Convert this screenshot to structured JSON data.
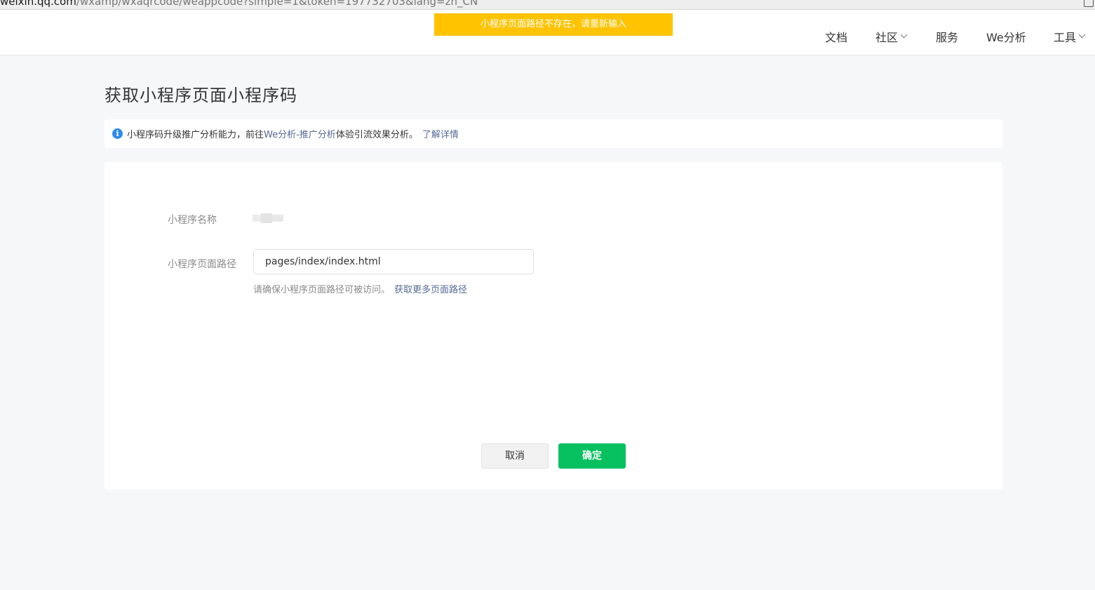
{
  "browser": {
    "url_host": "weixin.qq.com",
    "url_path": "/wxamp/wxaqrcode/weappcode?simple=1&token=197732703&lang=zh_CN"
  },
  "header": {
    "nav": [
      {
        "label": "文档",
        "has_dropdown": false
      },
      {
        "label": "社区",
        "has_dropdown": true
      },
      {
        "label": "服务",
        "has_dropdown": false
      },
      {
        "label": "We分析",
        "has_dropdown": false
      },
      {
        "label": "工具",
        "has_dropdown": true
      }
    ]
  },
  "toast": {
    "message": "小程序页面路径不存在，请重新输入",
    "color": "#ffc300"
  },
  "page": {
    "title": "获取小程序页面小程序码"
  },
  "notice": {
    "icon": "info-icon",
    "text_before": "小程序码升级推广分析能力，前往",
    "link_text": "We分析-推广分析",
    "text_after": "体验引流效果分析。",
    "more_link": "了解详情"
  },
  "form": {
    "name_label": "小程序名称",
    "path_label": "小程序页面路径",
    "path_value": "pages/index/index.html",
    "hint_text": "请确保小程序页面路径可被访问。",
    "hint_link": "获取更多页面路径"
  },
  "buttons": {
    "cancel": "取消",
    "confirm": "确定",
    "confirm_color": "#07c160"
  }
}
